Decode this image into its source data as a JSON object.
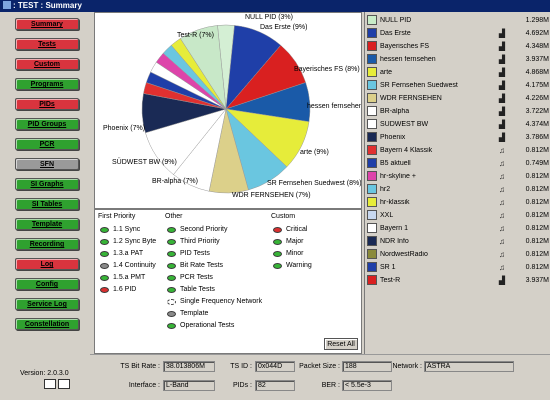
{
  "window": {
    "title": ": TEST : Summary"
  },
  "nav": [
    {
      "label": "Summary",
      "color": "#d9343e"
    },
    {
      "label": "Tests",
      "color": "#d9343e"
    },
    {
      "label": "Custom",
      "color": "#d9343e"
    },
    {
      "label": "Programs",
      "color": "#2fa12f"
    },
    {
      "label": "PIDs",
      "color": "#d9343e"
    },
    {
      "label": "PID Groups",
      "color": "#2fa12f"
    },
    {
      "label": "PCR",
      "color": "#2fa12f"
    },
    {
      "label": "SFN",
      "color": "#9a9a9a"
    },
    {
      "label": "SI Graphs",
      "color": "#2fa12f"
    },
    {
      "label": "SI Tables",
      "color": "#2fa12f"
    },
    {
      "label": "Template",
      "color": "#2fa12f"
    },
    {
      "label": "Recording",
      "color": "#2fa12f"
    },
    {
      "label": "Log",
      "color": "#d9343e"
    },
    {
      "label": "Config",
      "color": "#2fa12f"
    },
    {
      "label": "Service Log",
      "color": "#2fa12f"
    },
    {
      "label": "Constellation",
      "color": "#2fa12f"
    }
  ],
  "version": "Version: 2.0.3.0",
  "chart_data": {
    "type": "pie",
    "slices": [
      {
        "label": "NULL PID (3%)",
        "value": 3,
        "color": "#d4efd4"
      },
      {
        "label": "Das Erste (9%)",
        "value": 9,
        "color": "#1f3fa8"
      },
      {
        "label": "Bayerisches FS (8%)",
        "value": 8,
        "color": "#d92020"
      },
      {
        "label": "hessen fernsehen (7%)",
        "value": 7,
        "color": "#1a5aa8"
      },
      {
        "label": "arte (9%)",
        "value": 9,
        "color": "#e6ec3a"
      },
      {
        "label": "SR Fernsehen Suedwest (8%)",
        "value": 8,
        "color": "#6ac6e0"
      },
      {
        "label": "WDR FERNSEHEN (7%)",
        "value": 7,
        "color": "#dcd08a"
      },
      {
        "label": "BR-alpha (7%)",
        "value": 7,
        "color": "#ffffff"
      },
      {
        "label": "SÜDWEST BW (9%)",
        "value": 9,
        "color": "#ffffff"
      },
      {
        "label": "Phoenix (7%)",
        "value": 7,
        "color": "#1a2a55"
      },
      {
        "label": "",
        "value": 2,
        "color": "#e03030"
      },
      {
        "label": "",
        "value": 2,
        "color": "#1f3fa8"
      },
      {
        "label": "",
        "value": 2,
        "color": "#ffffff"
      },
      {
        "label": "",
        "value": 2,
        "color": "#dd44aa"
      },
      {
        "label": "",
        "value": 2,
        "color": "#6ac6e0"
      },
      {
        "label": "",
        "value": 2,
        "color": "#e6ec3a"
      },
      {
        "label": "Test-R (7%)",
        "value": 7,
        "color": "#c8e8c8"
      }
    ]
  },
  "priority": {
    "first_title": "First Priority",
    "other_title": "Other",
    "custom_title": "Custom",
    "first": [
      {
        "label": "1.1 Sync",
        "status": "green"
      },
      {
        "label": "1.2 Sync Byte",
        "status": "green"
      },
      {
        "label": "1.3.a PAT",
        "status": "green"
      },
      {
        "label": "1.4 Continuity",
        "status": "gray"
      },
      {
        "label": "1.5.a PMT",
        "status": "green"
      },
      {
        "label": "1.6 PID",
        "status": "red"
      }
    ],
    "other": [
      {
        "label": "Second Priority",
        "status": "green"
      },
      {
        "label": "Third Priority",
        "status": "green"
      },
      {
        "label": "PID Tests",
        "status": "green"
      },
      {
        "label": "Bit Rate Tests",
        "status": "green"
      },
      {
        "label": "PCR Tests",
        "status": "green"
      },
      {
        "label": "Table Tests",
        "status": "green"
      },
      {
        "label": "Single Frequency Network",
        "status": "sfn"
      },
      {
        "label": "Template",
        "status": "gray"
      },
      {
        "label": "Operational Tests",
        "status": "green"
      }
    ],
    "custom": [
      {
        "label": "Critical",
        "status": "red"
      },
      {
        "label": "Major",
        "status": "green"
      },
      {
        "label": "Minor",
        "status": "green"
      },
      {
        "label": "Warning",
        "status": "green"
      }
    ],
    "reset_label": "Reset All"
  },
  "streams": [
    {
      "name": "NULL PID",
      "rate": "1.298M",
      "color": "#c8ecc8",
      "icon": ""
    },
    {
      "name": "Das Erste",
      "rate": "4.692M",
      "color": "#1f3fa8",
      "icon": "tv-icon"
    },
    {
      "name": "Bayerisches FS",
      "rate": "4.348M",
      "color": "#d92020",
      "icon": "tv-icon"
    },
    {
      "name": "hessen fernsehen",
      "rate": "3.937M",
      "color": "#1a5aa8",
      "icon": "tv-icon"
    },
    {
      "name": "arte",
      "rate": "4.868M",
      "color": "#e6ec3a",
      "icon": "tv-icon"
    },
    {
      "name": "SR Fernsehen Suedwest",
      "rate": "4.175M",
      "color": "#6ac6e0",
      "icon": "tv-icon"
    },
    {
      "name": "WDR FERNSEHEN",
      "rate": "4.226M",
      "color": "#dcd08a",
      "icon": "tv-icon"
    },
    {
      "name": "BR-alpha",
      "rate": "3.722M",
      "color": "#ffffff",
      "icon": "tv-icon"
    },
    {
      "name": "SÜDWEST BW",
      "rate": "4.374M",
      "color": "#ffffff",
      "icon": "tv-icon"
    },
    {
      "name": "Phoenix",
      "rate": "3.786M",
      "color": "#1a2a55",
      "icon": "tv-icon"
    },
    {
      "name": "Bayern 4 Klassik",
      "rate": "0.812M",
      "color": "#e03030",
      "icon": "music-icon"
    },
    {
      "name": "B5 aktuell",
      "rate": "0.749M",
      "color": "#1f3fa8",
      "icon": "music-icon"
    },
    {
      "name": "hr-skyline +",
      "rate": "0.812M",
      "color": "#dd44aa",
      "icon": "music-icon"
    },
    {
      "name": "hr2",
      "rate": "0.812M",
      "color": "#6ac6e0",
      "icon": "music-icon"
    },
    {
      "name": "hr-klassik",
      "rate": "0.812M",
      "color": "#e6ec3a",
      "icon": "music-icon"
    },
    {
      "name": "XXL",
      "rate": "0.812M",
      "color": "#c8d8f0",
      "icon": "music-icon"
    },
    {
      "name": "Bayern 1",
      "rate": "0.812M",
      "color": "#ffffff",
      "icon": "music-icon"
    },
    {
      "name": "NDR Info",
      "rate": "0.812M",
      "color": "#1a2a55",
      "icon": "music-icon"
    },
    {
      "name": "NordwestRadio",
      "rate": "0.812M",
      "color": "#8a8a3a",
      "icon": "music-icon"
    },
    {
      "name": "SR 1",
      "rate": "0.812M",
      "color": "#1f3fa8",
      "icon": "music-icon"
    },
    {
      "name": "Test-R",
      "rate": "3.937M",
      "color": "#d92020",
      "icon": "tv-icon"
    }
  ],
  "info": {
    "ts_bitrate_label": "TS Bit Rate :",
    "ts_bitrate_value": "38.013806M",
    "ts_id_label": "TS ID :",
    "ts_id_value": "0x044D",
    "packet_size_label": "Packet Size :",
    "packet_size_value": "188",
    "network_label": "Network :",
    "network_value": "ASTRA",
    "interface_label": "Interface :",
    "interface_value": "L-Band",
    "pids_label": "PIDs :",
    "pids_value": "82",
    "ber_label": "BER :",
    "ber_value": "< 5.5e-3"
  }
}
